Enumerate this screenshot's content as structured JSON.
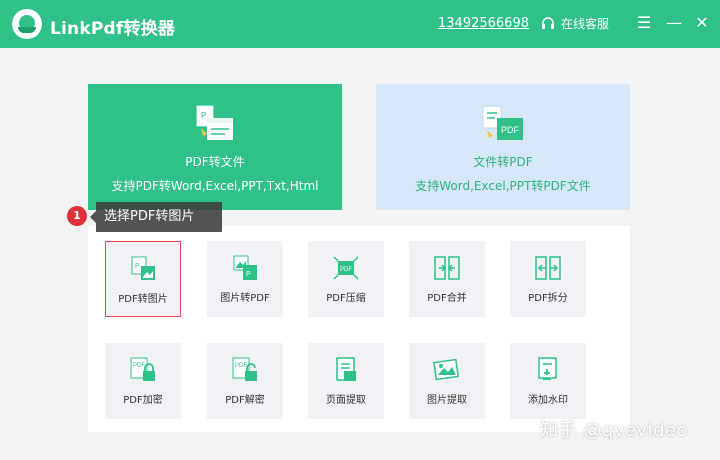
{
  "app": {
    "title": "LinkPdf转换器"
  },
  "header": {
    "phone": "13492566698",
    "support": "在线客服"
  },
  "window_controls": {
    "menu": "☰",
    "minimize": "—",
    "close": "✕"
  },
  "cards": [
    {
      "title": "PDF转文件",
      "subtitle": "支持PDF转Word,Excel,PPT,Txt,Html"
    },
    {
      "title": "文件转PDF",
      "subtitle": "支持Word,Excel,PPT转PDF文件"
    }
  ],
  "tooltip": {
    "step": "1",
    "text": "选择PDF转图片"
  },
  "tools": [
    {
      "label": "PDF转图片",
      "icon": "pdf-to-image-icon"
    },
    {
      "label": "图片转PDF",
      "icon": "image-to-pdf-icon"
    },
    {
      "label": "PDF压缩",
      "icon": "pdf-compress-icon"
    },
    {
      "label": "PDF合并",
      "icon": "pdf-merge-icon"
    },
    {
      "label": "PDF拆分",
      "icon": "pdf-split-icon"
    },
    {
      "label": "PDF加密",
      "icon": "pdf-encrypt-icon"
    },
    {
      "label": "PDF解密",
      "icon": "pdf-decrypt-icon"
    },
    {
      "label": "页面提取",
      "icon": "page-extract-icon"
    },
    {
      "label": "图片提取",
      "icon": "image-extract-icon"
    },
    {
      "label": "添加水印",
      "icon": "watermark-icon"
    }
  ],
  "watermark": {
    "text": "知乎 @qvevideo"
  },
  "colors": {
    "brand": "#2fc187",
    "blue_card": "#d6e8f7",
    "highlight": "#e0474f",
    "badge": "#e0303a"
  }
}
